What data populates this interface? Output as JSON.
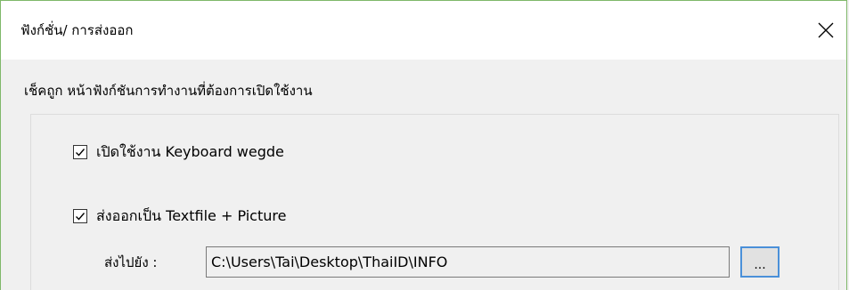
{
  "window": {
    "title": "ฟังก์ชั่น/ การส่งออก",
    "close_icon": "close-icon"
  },
  "instruction": "เช็คถูก หน้าฟังก์ชันการทำงานที่ต้องการเปิดใช้งาน",
  "options": [
    {
      "label": "เปิดใช้งาน Keyboard wegde",
      "checked": true
    },
    {
      "label": "ส่งออกเป็น Textfile + Picture",
      "checked": true
    }
  ],
  "export": {
    "dest_label": "ส่งไปยัง :",
    "path_value": "C:\\Users\\Tai\\Desktop\\ThaiID\\INFO",
    "browse_label": "..."
  },
  "colors": {
    "window_border": "#7fb86a",
    "background": "#f0f0f0",
    "focus_border": "#4a90d9"
  }
}
